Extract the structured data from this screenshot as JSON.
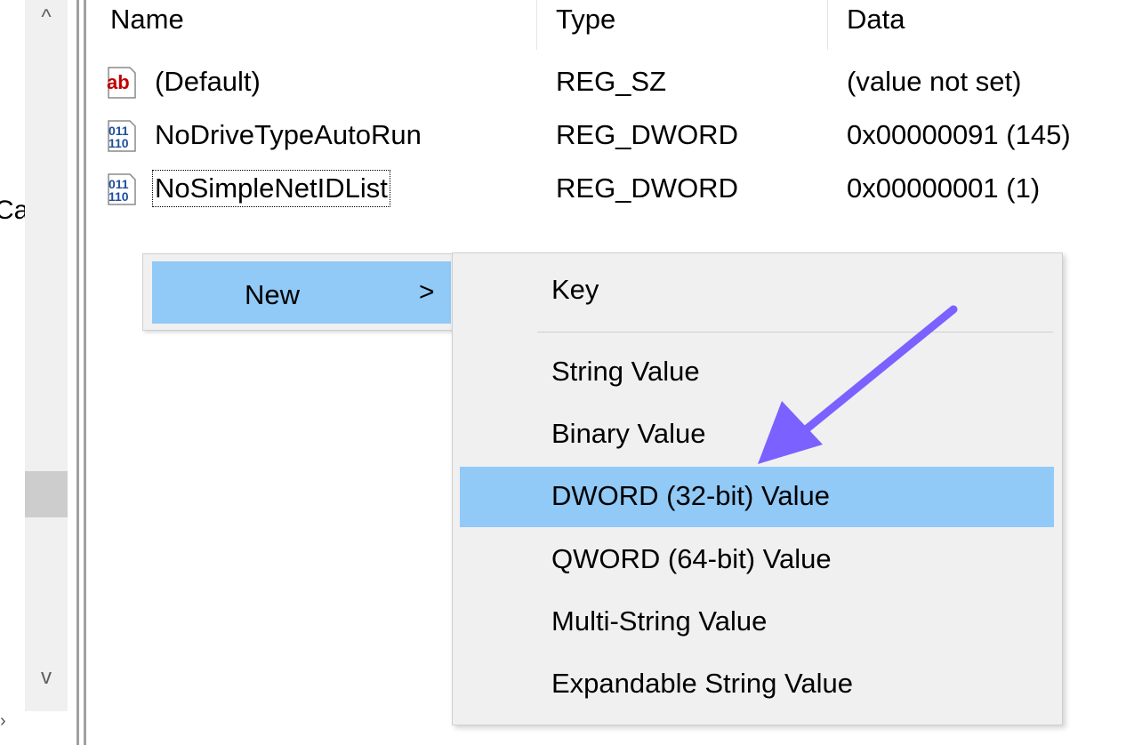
{
  "tree": {
    "clipped_text": "Ca",
    "expand_arrow": "›"
  },
  "scrollbar": {
    "up_glyph": "^",
    "down_glyph": "v"
  },
  "columns": {
    "name": "Name",
    "type": "Type",
    "data": "Data"
  },
  "values": [
    {
      "name": "(Default)",
      "type": "REG_SZ",
      "data": "(value not set)",
      "icon": "string-value-icon",
      "icon_text": "ab"
    },
    {
      "name": "NoDriveTypeAutoRun",
      "type": "REG_DWORD",
      "data": "0x00000091 (145)",
      "icon": "binary-value-icon",
      "icon_text": "011 110"
    },
    {
      "name": "NoSimpleNetIDList",
      "type": "REG_DWORD",
      "data": "0x00000001 (1)",
      "icon": "binary-value-icon",
      "icon_text": "011 110"
    }
  ],
  "context_menu": {
    "new_label": "New",
    "submenu_glyph": ">"
  },
  "submenu": {
    "items": [
      "Key",
      "String Value",
      "Binary Value",
      "DWORD (32-bit) Value",
      "QWORD (64-bit) Value",
      "Multi-String Value",
      "Expandable String Value"
    ],
    "highlighted": "DWORD (32-bit) Value"
  },
  "colors": {
    "highlight": "#91c9f7",
    "menu_bg": "#f0f0f0",
    "arrow": "#7b61ff",
    "string_icon_red": "#c00000",
    "binary_icon_blue": "#1f4e9b"
  }
}
